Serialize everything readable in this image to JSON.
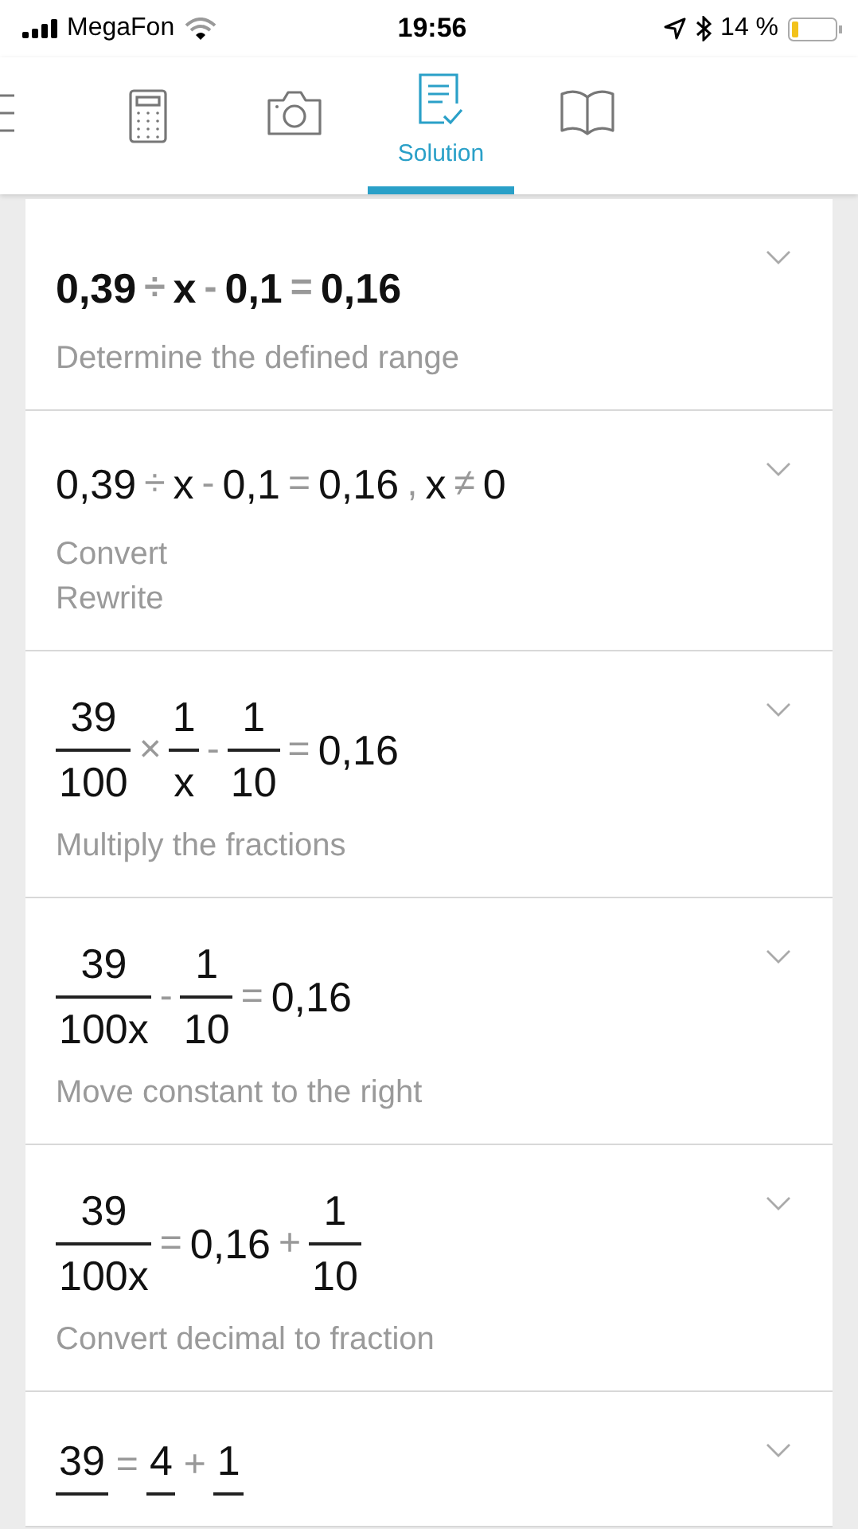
{
  "status_bar": {
    "carrier": "MegaFon",
    "time": "19:56",
    "battery": "14 %"
  },
  "tabs": [
    {
      "kind": "menu",
      "selected": false
    },
    {
      "kind": "calculator",
      "selected": false
    },
    {
      "kind": "camera",
      "selected": false
    },
    {
      "kind": "solution",
      "label": "Solution",
      "selected": true
    },
    {
      "kind": "book",
      "selected": false
    }
  ],
  "steps": [
    {
      "bold": true,
      "expression": [
        {
          "kind": "num",
          "text": "0,39"
        },
        {
          "kind": "op",
          "text": "÷"
        },
        {
          "kind": "num",
          "text": "x"
        },
        {
          "kind": "op",
          "text": "-"
        },
        {
          "kind": "num",
          "text": "0,1"
        },
        {
          "kind": "op",
          "text": "="
        },
        {
          "kind": "num",
          "text": "0,16"
        }
      ],
      "descriptions": [
        "Determine the defined range"
      ]
    },
    {
      "bold": false,
      "expression": [
        {
          "kind": "num",
          "text": "0,39"
        },
        {
          "kind": "op",
          "text": "÷"
        },
        {
          "kind": "num",
          "text": "x"
        },
        {
          "kind": "op",
          "text": "-"
        },
        {
          "kind": "num",
          "text": "0,1"
        },
        {
          "kind": "op",
          "text": "="
        },
        {
          "kind": "num",
          "text": "0,16"
        },
        {
          "kind": "op",
          "text": ","
        },
        {
          "kind": "num",
          "text": "x"
        },
        {
          "kind": "op",
          "text": "≠"
        },
        {
          "kind": "num",
          "text": "0"
        }
      ],
      "descriptions": [
        "Convert",
        "Rewrite"
      ]
    },
    {
      "bold": false,
      "expression": [
        {
          "kind": "frac",
          "num": "39",
          "den": "100"
        },
        {
          "kind": "op",
          "text": "×"
        },
        {
          "kind": "frac",
          "num": "1",
          "den": "x"
        },
        {
          "kind": "op",
          "text": "-"
        },
        {
          "kind": "frac",
          "num": "1",
          "den": "10"
        },
        {
          "kind": "op",
          "text": "="
        },
        {
          "kind": "num",
          "text": "0,16"
        }
      ],
      "descriptions": [
        "Multiply the fractions"
      ]
    },
    {
      "bold": false,
      "expression": [
        {
          "kind": "frac",
          "num": "39",
          "den": "100x"
        },
        {
          "kind": "op",
          "text": "-"
        },
        {
          "kind": "frac",
          "num": "1",
          "den": "10"
        },
        {
          "kind": "op",
          "text": "="
        },
        {
          "kind": "num",
          "text": "0,16"
        }
      ],
      "descriptions": [
        "Move constant to the right"
      ]
    },
    {
      "bold": false,
      "expression": [
        {
          "kind": "frac",
          "num": "39",
          "den": "100x"
        },
        {
          "kind": "op",
          "text": "="
        },
        {
          "kind": "num",
          "text": "0,16"
        },
        {
          "kind": "op",
          "text": "+"
        },
        {
          "kind": "frac",
          "num": "1",
          "den": "10"
        }
      ],
      "descriptions": [
        "Convert decimal to fraction"
      ]
    },
    {
      "bold": false,
      "expression": [
        {
          "kind": "frac",
          "num": "39"
        },
        {
          "kind": "op",
          "text": "="
        },
        {
          "kind": "frac",
          "num": "4"
        },
        {
          "kind": "op",
          "text": "+"
        },
        {
          "kind": "frac",
          "num": "1"
        }
      ]
    }
  ]
}
